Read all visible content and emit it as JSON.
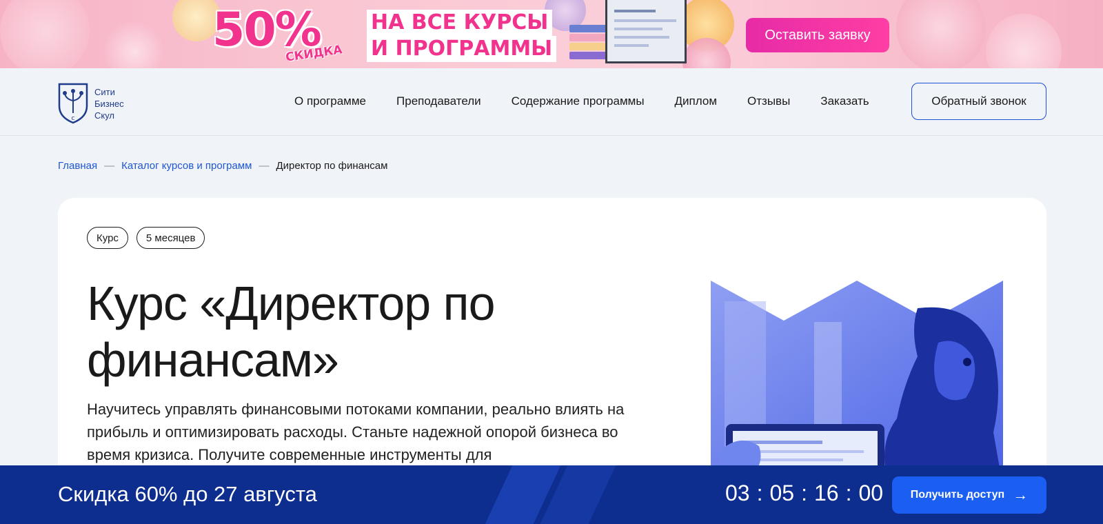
{
  "promo": {
    "percent": "50%",
    "sale_label": "СКИДКА",
    "line1": "НА ВСЕ КУРСЫ",
    "line2": "И ПРОГРАММЫ",
    "cta": "Оставить заявку",
    "colors": {
      "accent": "#f2338e",
      "cta": "#e62ba6"
    }
  },
  "header": {
    "logo_lines": [
      "Сити",
      "Бизнес",
      "Скул"
    ],
    "nav": [
      "О программе",
      "Преподаватели",
      "Содержание программы",
      "Диплом",
      "Отзывы",
      "Заказать"
    ],
    "callback": "Обратный звонок"
  },
  "breadcrumb": {
    "items": [
      "Главная",
      "Каталог курсов и программ"
    ],
    "separator": "—",
    "current": "Директор по финансам"
  },
  "course": {
    "tags": [
      "Курс",
      "5 месяцев"
    ],
    "title": "Курс «Директор по финансам»",
    "description": "Научитесь управлять финансовыми потоками компании, реально влиять на прибыль и оптимизировать расходы. Станьте надежной опорой бизнеса во время кризиса. Получите современные инструменты для"
  },
  "bottom_bar": {
    "offer": "Скидка 60% до 27 августа",
    "timer": [
      "03",
      "05",
      "16",
      "00"
    ],
    "timer_separator": ":",
    "button": "Получить доступ",
    "colors": {
      "background": "#0d2e8f",
      "button": "#1b5ef2"
    }
  }
}
